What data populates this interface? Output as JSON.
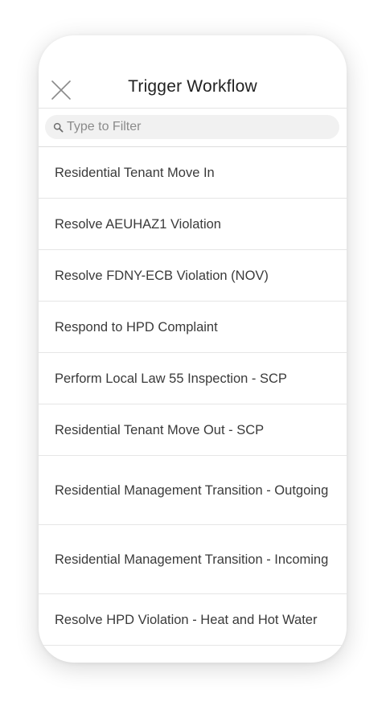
{
  "header": {
    "title": "Trigger Workflow",
    "close_icon": "close-icon"
  },
  "search": {
    "placeholder": "Type to Filter",
    "value": "",
    "icon": "search-icon"
  },
  "workflows": [
    {
      "label": "Residential Tenant Move In"
    },
    {
      "label": "Resolve AEUHAZ1 Violation"
    },
    {
      "label": "Resolve FDNY-ECB Violation (NOV)"
    },
    {
      "label": "Respond to HPD Complaint"
    },
    {
      "label": "Perform Local Law 55 Inspection - SCP"
    },
    {
      "label": "Residential Tenant Move Out - SCP"
    },
    {
      "label": "Residential Management Transition - Outgoing"
    },
    {
      "label": "Residential Management Transition - Incoming"
    },
    {
      "label": "Resolve HPD Violation - Heat and Hot Water"
    }
  ]
}
